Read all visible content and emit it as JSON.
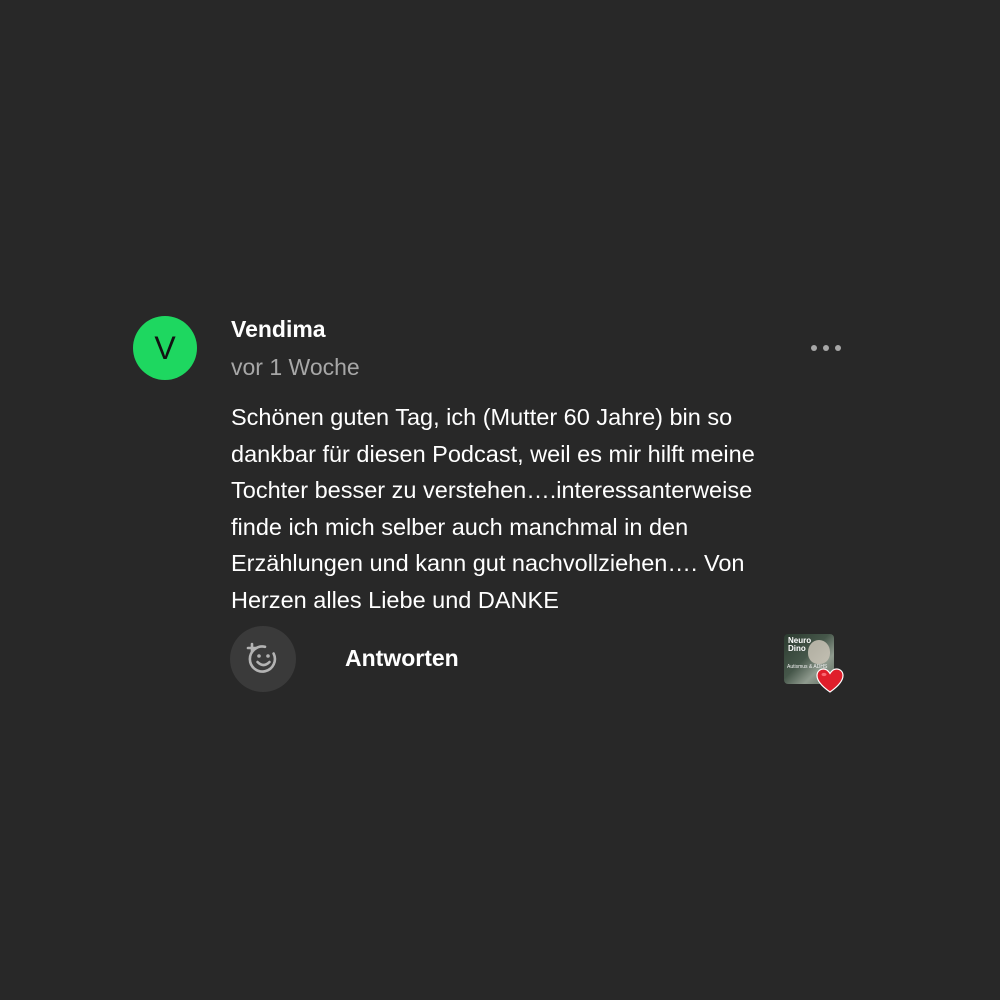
{
  "comment": {
    "avatar_letter": "V",
    "username": "Vendima",
    "timestamp": "vor 1 Woche",
    "text": "Schönen guten Tag, ich (Mutter 60 Jahre) bin so\ndankbar für diesen Podcast, weil es mir hilft meine\nTochter besser zu verstehen….interessanterweise\nfinde ich mich selber auch manchmal in den\nErzählungen und kann gut nachvollziehen…. Von\nHerzen alles Liebe und DANKE",
    "more_icon": "more-horizontal-icon",
    "avatar_color": "#1ed760"
  },
  "actions": {
    "reaction_icon": "add-reaction-icon",
    "reply_label": "Antworten"
  },
  "reaction": {
    "thumbnail_title": "Neuro Dino",
    "thumbnail_subtitle": "Autismus & ADHS",
    "heart_icon": "heart-icon",
    "heart_color": "#e01e2b"
  },
  "colors": {
    "background": "#282828",
    "text_primary": "#ffffff",
    "text_secondary": "#a7a7a7"
  }
}
